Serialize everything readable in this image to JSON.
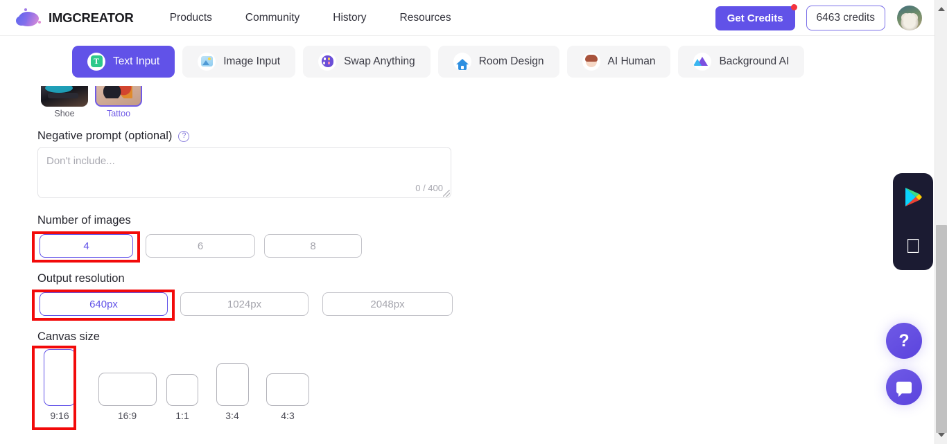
{
  "header": {
    "brand": "IMGCREATOR",
    "nav": [
      {
        "label": "Products"
      },
      {
        "label": "Community"
      },
      {
        "label": "History"
      },
      {
        "label": "Resources"
      }
    ],
    "get_credits_label": "Get Credits",
    "credits_label": "6463 credits",
    "accent_color": "#6152e8",
    "notification_color": "#f4333d"
  },
  "tabs": [
    {
      "label": "Text Input",
      "icon": "text-input-icon",
      "active": true
    },
    {
      "label": "Image Input",
      "icon": "image-input-icon",
      "active": false
    },
    {
      "label": "Swap Anything",
      "icon": "palette-icon",
      "active": false
    },
    {
      "label": "Room Design",
      "icon": "home-icon",
      "active": false
    },
    {
      "label": "AI Human",
      "icon": "person-icon",
      "active": false
    },
    {
      "label": "Background AI",
      "icon": "mountain-icon",
      "active": false
    }
  ],
  "styles": [
    {
      "label": "Shoe",
      "selected": false
    },
    {
      "label": "Tattoo",
      "selected": true
    }
  ],
  "negative_prompt": {
    "label": "Negative prompt (optional)",
    "help_icon": "question-circle-icon",
    "placeholder": "Don't include...",
    "value": "",
    "counter": "0 / 400"
  },
  "number_of_images": {
    "label": "Number of images",
    "options": [
      {
        "label": "4",
        "selected": true
      },
      {
        "label": "6",
        "selected": false
      },
      {
        "label": "8",
        "selected": false
      }
    ],
    "highlighted": true
  },
  "output_resolution": {
    "label": "Output resolution",
    "options": [
      {
        "label": "640px",
        "selected": true
      },
      {
        "label": "1024px",
        "selected": false
      },
      {
        "label": "2048px",
        "selected": false
      }
    ],
    "highlighted": true
  },
  "canvas_size": {
    "label": "Canvas size",
    "options": [
      {
        "label": "9:16",
        "selected": true
      },
      {
        "label": "16:9",
        "selected": false
      },
      {
        "label": "1:1",
        "selected": false
      },
      {
        "label": "3:4",
        "selected": false
      },
      {
        "label": "4:3",
        "selected": false
      }
    ],
    "highlighted": true
  },
  "floating": {
    "store_panel": {
      "google_play": "google-play-icon",
      "apple": "apple-icon"
    },
    "help_label": "?",
    "chat_icon": "chat-bubble-icon"
  },
  "annotation": {
    "color": "#f20a0a"
  }
}
